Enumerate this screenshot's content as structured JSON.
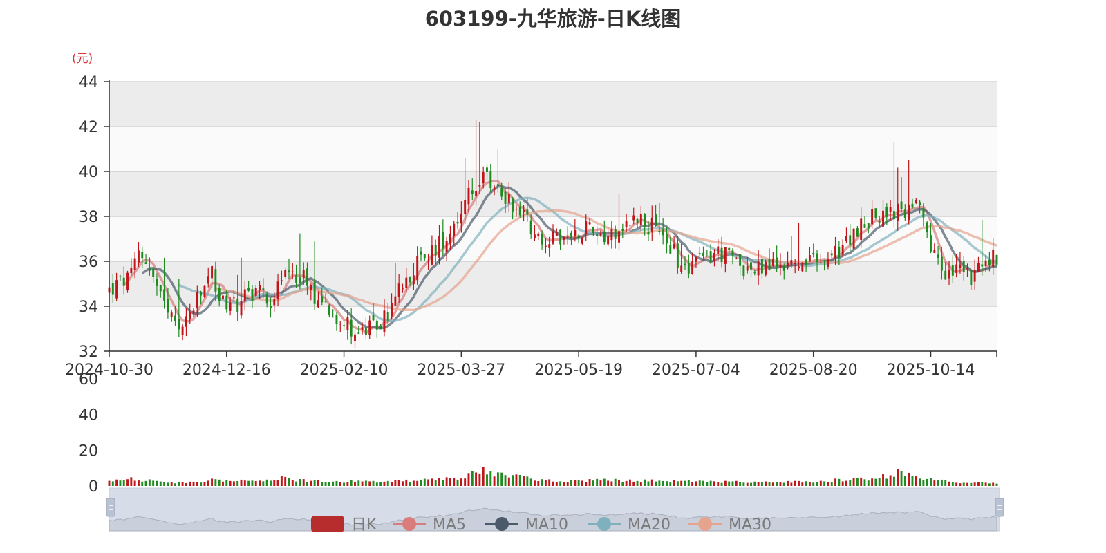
{
  "chart_data": {
    "type": "candlestick",
    "title": "603199-九华旅游-日K线图",
    "unit_label": "(元)",
    "price_axis": {
      "ylim": [
        32,
        44
      ],
      "ticks": [
        "32",
        "34",
        "36",
        "38",
        "40",
        "42",
        "44"
      ]
    },
    "volume_axis": {
      "ylim": [
        0,
        60
      ],
      "ticks": [
        "0",
        "20",
        "40",
        "60"
      ]
    },
    "x_date_range": [
      "2024-10-30",
      "2025-10-16"
    ],
    "x_tick_labels": [
      "2024-10-30",
      "2024-12-16",
      "2025-02-10",
      "2025-03-27",
      "2025-05-19",
      "2025-07-04",
      "2025-08-20",
      "2025-10-14"
    ],
    "x_tick_index": [
      0,
      32,
      64,
      96,
      128,
      160,
      192,
      224
    ],
    "up_color": "#c0161a",
    "down_color": "#1f8a1f",
    "legend": [
      "日K",
      "MA5",
      "MA10",
      "MA20",
      "MA30"
    ],
    "legend_colors": [
      "#c0161a",
      "#d97c7c",
      "#4a5a6a",
      "#7fb0bd",
      "#e6a48f"
    ],
    "close_anchors": [
      [
        0,
        34.7
      ],
      [
        6,
        35.3
      ],
      [
        8,
        36.4
      ],
      [
        10,
        36.1
      ],
      [
        14,
        34.3
      ],
      [
        18,
        33.0
      ],
      [
        21,
        33.4
      ],
      [
        24,
        34.2
      ],
      [
        28,
        35.4
      ],
      [
        30,
        34.4
      ],
      [
        34,
        34.0
      ],
      [
        37,
        34.5
      ],
      [
        40,
        34.8
      ],
      [
        44,
        34.3
      ],
      [
        49,
        35.6
      ],
      [
        53,
        35.3
      ],
      [
        56,
        34.5
      ],
      [
        60,
        34.0
      ],
      [
        64,
        33.3
      ],
      [
        68,
        32.8
      ],
      [
        72,
        33.0
      ],
      [
        76,
        33.6
      ],
      [
        80,
        35.1
      ],
      [
        84,
        35.9
      ],
      [
        88,
        36.4
      ],
      [
        92,
        37.2
      ],
      [
        96,
        38.3
      ],
      [
        100,
        39.4
      ],
      [
        103,
        39.6
      ],
      [
        108,
        38.9
      ],
      [
        112,
        38.3
      ],
      [
        118,
        37.0
      ],
      [
        124,
        36.9
      ],
      [
        130,
        37.6
      ],
      [
        136,
        37.2
      ],
      [
        140,
        37.6
      ],
      [
        144,
        38.0
      ],
      [
        148,
        37.5
      ],
      [
        152,
        36.9
      ],
      [
        156,
        35.8
      ],
      [
        160,
        35.9
      ],
      [
        166,
        36.4
      ],
      [
        172,
        35.9
      ],
      [
        176,
        35.5
      ],
      [
        180,
        35.8
      ],
      [
        186,
        35.9
      ],
      [
        192,
        35.9
      ],
      [
        196,
        36.0
      ],
      [
        200,
        36.6
      ],
      [
        206,
        37.8
      ],
      [
        212,
        38.2
      ],
      [
        216,
        38.1
      ],
      [
        220,
        38.6
      ],
      [
        224,
        36.5
      ],
      [
        228,
        35.3
      ],
      [
        231,
        35.6
      ],
      [
        234,
        35.3
      ],
      [
        237,
        35.5
      ],
      [
        241,
        36.2
      ],
      [
        242,
        36.0
      ]
    ],
    "volume_anchors": [
      [
        0,
        2.6
      ],
      [
        6,
        4.0
      ],
      [
        10,
        3.2
      ],
      [
        20,
        1.8
      ],
      [
        30,
        3.5
      ],
      [
        40,
        2.2
      ],
      [
        45,
        4.5
      ],
      [
        56,
        2.8
      ],
      [
        64,
        2.4
      ],
      [
        76,
        2.5
      ],
      [
        88,
        3.5
      ],
      [
        96,
        5.2
      ],
      [
        102,
        9.5
      ],
      [
        106,
        6.5
      ],
      [
        115,
        4.0
      ],
      [
        125,
        3.0
      ],
      [
        140,
        3.2
      ],
      [
        160,
        2.5
      ],
      [
        180,
        2.2
      ],
      [
        192,
        2.5
      ],
      [
        200,
        3.5
      ],
      [
        210,
        4.5
      ],
      [
        216,
        8.0
      ],
      [
        222,
        4.5
      ],
      [
        230,
        2.2
      ],
      [
        242,
        1.5
      ]
    ],
    "series": [
      {
        "name": "日K",
        "kind": "candlestick"
      },
      {
        "name": "MA5",
        "period": 5
      },
      {
        "name": "MA10",
        "period": 10
      },
      {
        "name": "MA20",
        "period": 20
      },
      {
        "name": "MA30",
        "period": 30
      }
    ],
    "n_candles": 243,
    "grid": true,
    "legend_position": "bottom"
  }
}
